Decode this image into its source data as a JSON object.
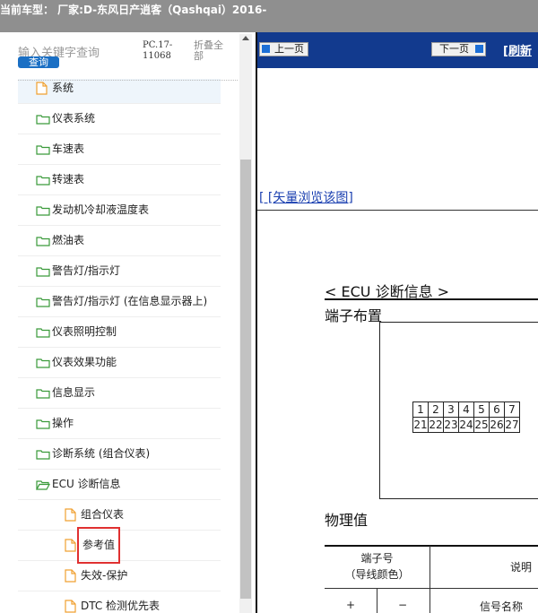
{
  "header": {
    "title": "当前车型： 厂家:D-东风日产逍客（Qashqai）2016-"
  },
  "sidebar": {
    "search_placeholder": "输入关键字查询",
    "search_button": "查询",
    "pc_version": "PC.17-\n11068",
    "collapse_all": "折叠全部",
    "items": [
      {
        "label": "系统",
        "icon": "page-icon",
        "state": "selected"
      },
      {
        "label": "仪表系统",
        "icon": "folder-icon"
      },
      {
        "label": "车速表",
        "icon": "folder-icon"
      },
      {
        "label": "转速表",
        "icon": "folder-icon"
      },
      {
        "label": "发动机冷却液温度表",
        "icon": "folder-icon"
      },
      {
        "label": "燃油表",
        "icon": "folder-icon"
      },
      {
        "label": "警告灯/指示灯",
        "icon": "folder-icon"
      },
      {
        "label": "警告灯/指示灯 (在信息显示器上)",
        "icon": "folder-icon"
      },
      {
        "label": "仪表照明控制",
        "icon": "folder-icon"
      },
      {
        "label": "仪表效果功能",
        "icon": "folder-icon"
      },
      {
        "label": "信息显示",
        "icon": "folder-icon"
      },
      {
        "label": "操作",
        "icon": "folder-icon"
      },
      {
        "label": "诊断系统 (组合仪表)",
        "icon": "folder-icon"
      },
      {
        "label": "ECU 诊断信息",
        "icon": "folder-open-icon"
      },
      {
        "label": "组合仪表",
        "icon": "page-icon"
      },
      {
        "label": "参考值",
        "icon": "page-icon",
        "state": "highlighted"
      },
      {
        "label": "失效-保护",
        "icon": "page-icon"
      },
      {
        "label": "DTC 检测优先表",
        "icon": "page-icon"
      }
    ]
  },
  "main": {
    "prev_button": "上一页",
    "next_button": "下一页",
    "refresh_link": "[刷新",
    "vector_link": "[ [矢量浏览该图]",
    "doc_heading": "< ECU 诊断信息 >",
    "terminal_layout": "端子布置",
    "connector_row1": [
      "1",
      "2",
      "3",
      "4",
      "5",
      "6",
      "7"
    ],
    "connector_row2": [
      "21",
      "22",
      "23",
      "24",
      "25",
      "26",
      "27"
    ],
    "physical_values": "物理值",
    "table": {
      "col_terminal": "端子号",
      "col_terminal_sub": "（导线颜色）",
      "col_desc": "说明",
      "plus": "+",
      "minus": "−",
      "signal_name": "信号名称"
    }
  },
  "colors": {
    "navbar": "#123a8e",
    "topbar": "#8f8f8f",
    "search_button": "#1a6fc4",
    "highlight_border": "#e03030"
  }
}
